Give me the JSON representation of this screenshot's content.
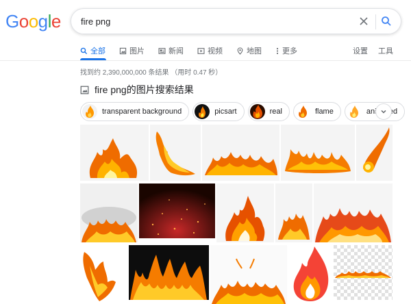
{
  "logo": {
    "letters": [
      "G",
      "o",
      "o",
      "g",
      "l",
      "e"
    ],
    "colors": [
      "#4285f4",
      "#ea4335",
      "#fbbc05",
      "#4285f4",
      "#34a853",
      "#ea4335"
    ]
  },
  "search": {
    "value": "fire png"
  },
  "tabs": [
    {
      "label": "全部",
      "icon": "search-icon",
      "active": true
    },
    {
      "label": "图片",
      "icon": "image-icon"
    },
    {
      "label": "新闻",
      "icon": "news-icon"
    },
    {
      "label": "视频",
      "icon": "video-icon"
    },
    {
      "label": "地图",
      "icon": "map-pin-icon"
    },
    {
      "label": "更多",
      "icon": "more-vert-icon"
    }
  ],
  "tools": {
    "settings": "设置",
    "tools": "工具"
  },
  "stats": "找到约 2,390,000,000 条结果 （用时 0.47 秒）",
  "image_heading": "fire png的图片搜索结果",
  "chips": [
    {
      "label": "transparent background"
    },
    {
      "label": "picsart"
    },
    {
      "label": "real"
    },
    {
      "label": "flame"
    },
    {
      "label": "animated"
    }
  ],
  "colors": {
    "accent": "#1a73e8",
    "border": "#dfe1e5",
    "fire_orange": "#f57c00",
    "fire_yellow": "#ffd54f"
  }
}
